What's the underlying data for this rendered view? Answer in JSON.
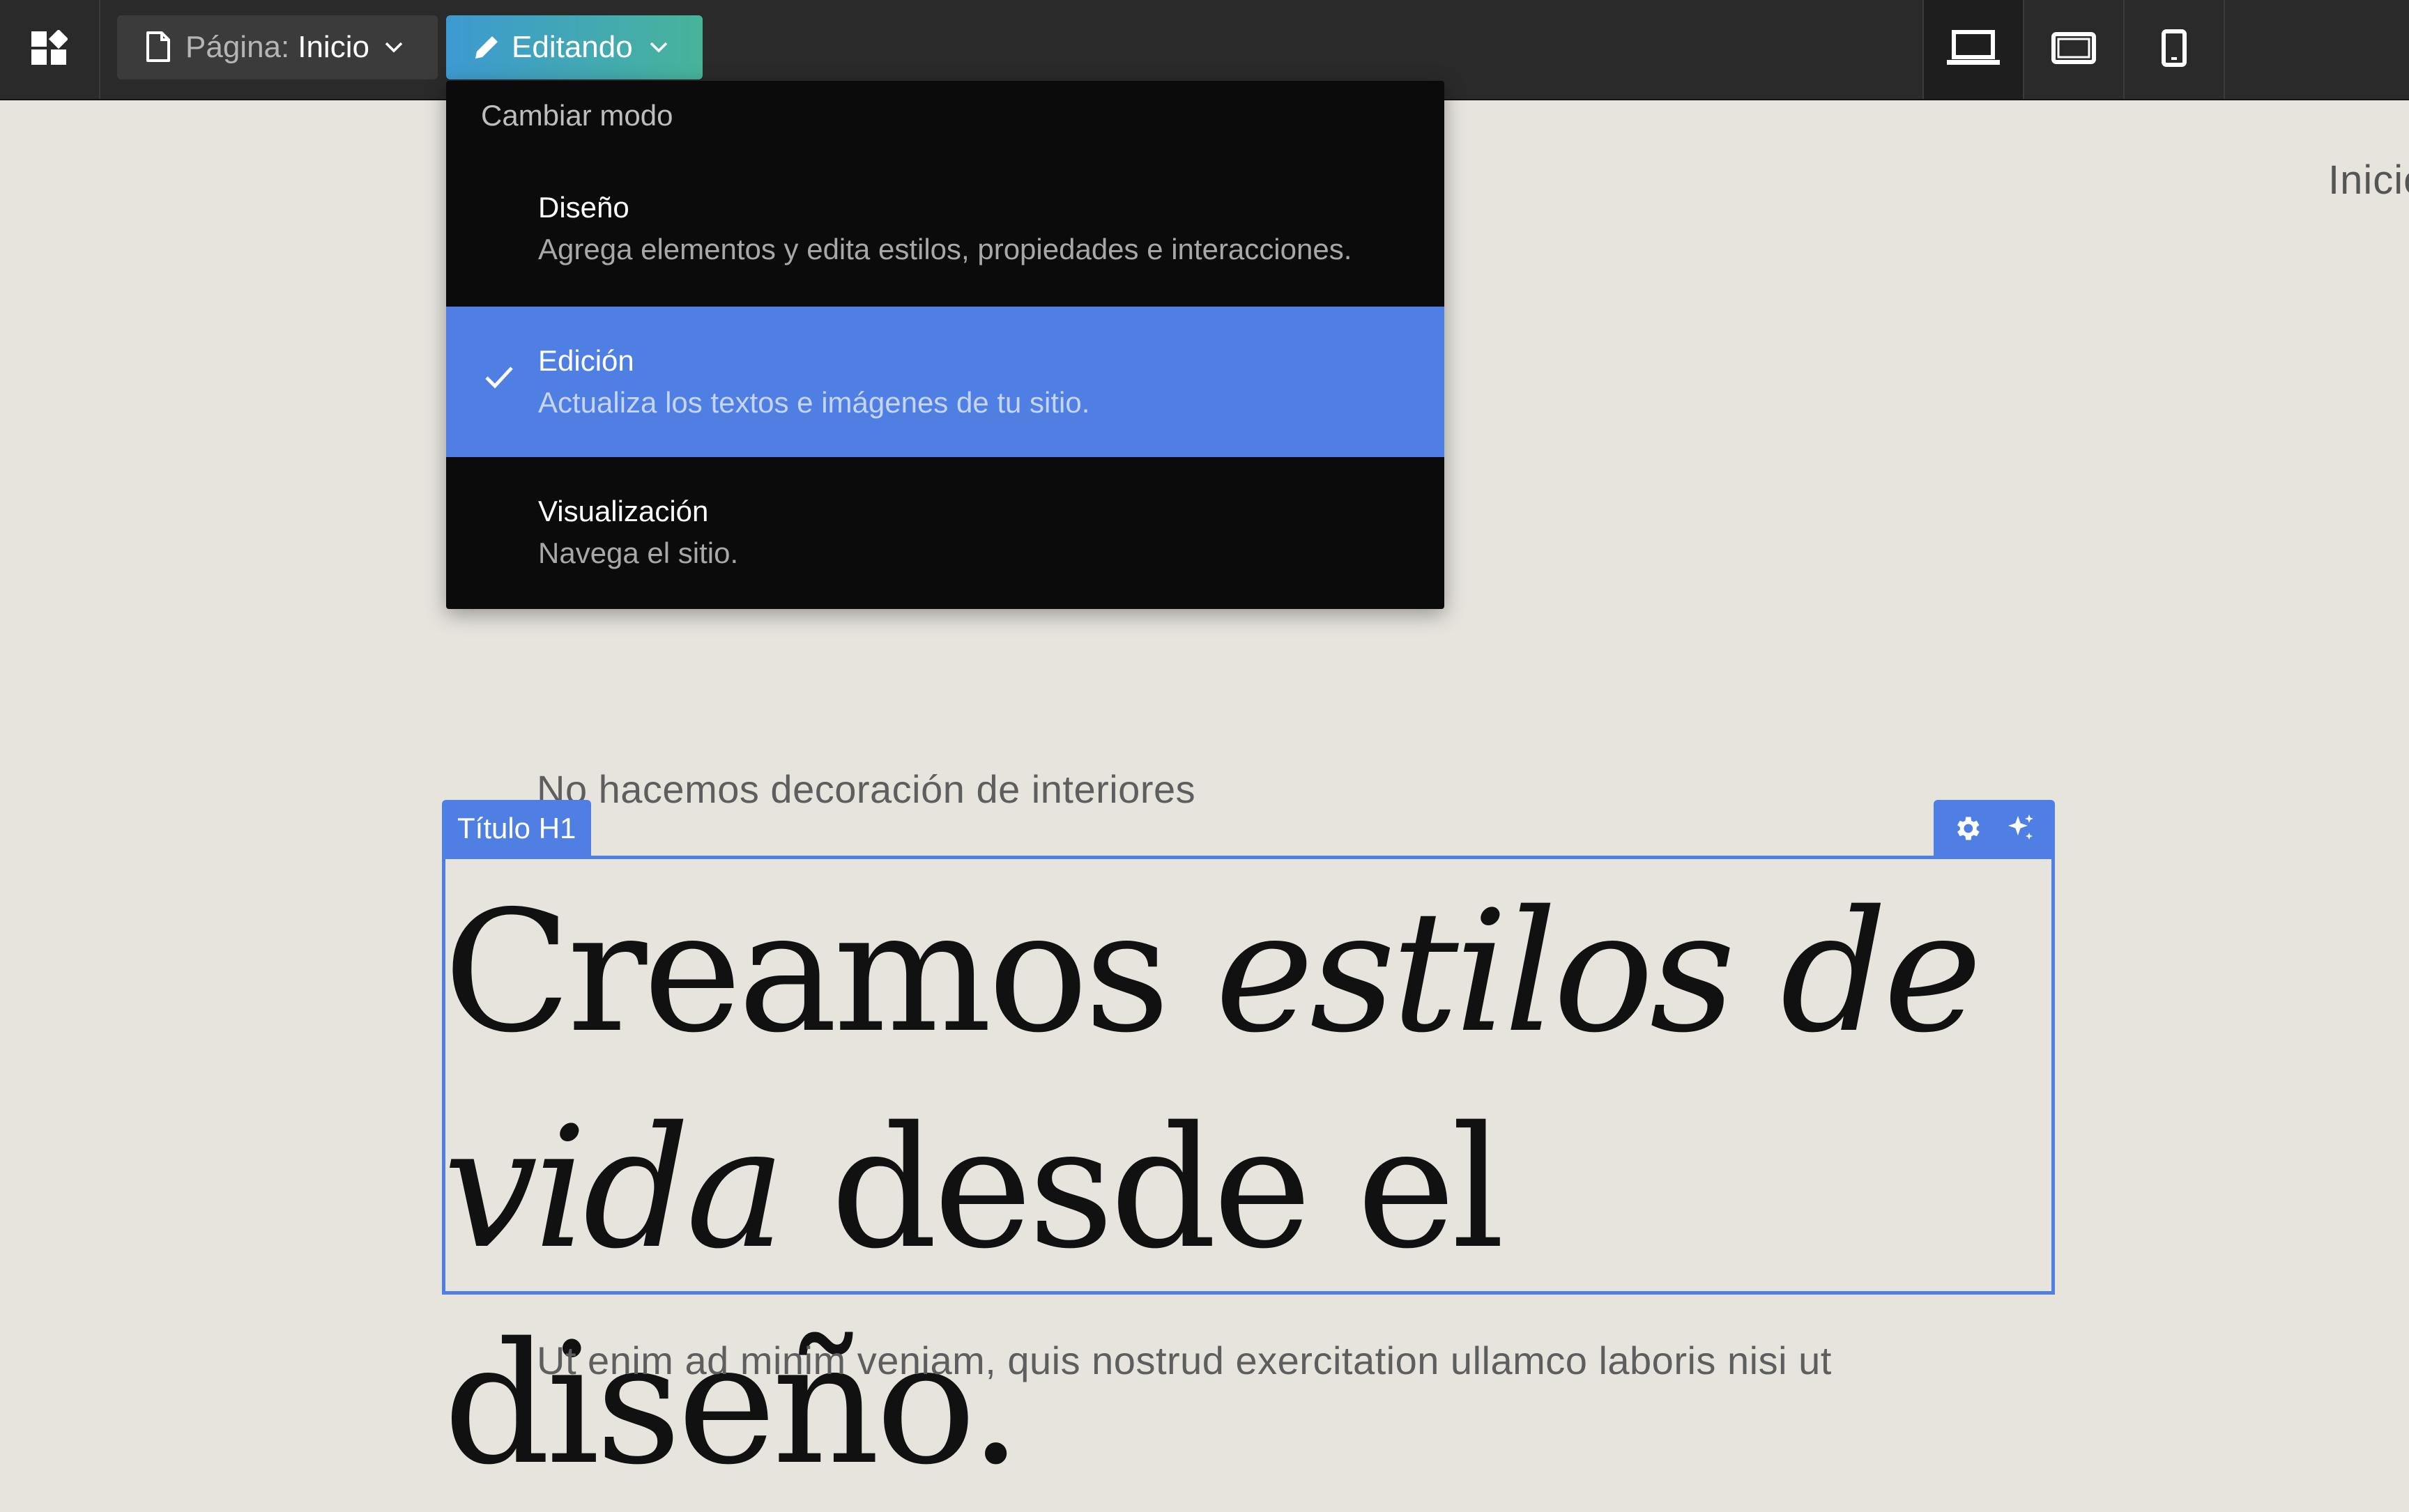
{
  "topbar": {
    "page_prefix": "Página:",
    "page_name": "Inicio",
    "mode_label": "Editando",
    "icons": {
      "logo": "webflow-grid-logo-icon",
      "page": "document-icon",
      "mode": "pencil-icon",
      "chevron": "chevron-down-icon",
      "devices": [
        "laptop-icon",
        "tablet-landscape-icon",
        "mobile-icon"
      ]
    },
    "active_device": "laptop"
  },
  "mode_menu": {
    "header": "Cambiar modo",
    "items": [
      {
        "title": "Diseño",
        "description": "Agrega elementos y edita estilos, propiedades e interacciones.",
        "selected": false
      },
      {
        "title": "Edición",
        "description": "Actualiza los textos e imágenes de tu sitio.",
        "selected": true
      },
      {
        "title": "Visualización",
        "description": "Navega el sitio.",
        "selected": false
      }
    ]
  },
  "canvas": {
    "nav_link": "Inicio",
    "eyebrow": "No hacemos decoración de interiores",
    "selection_label": "Título H1",
    "selection_tools": [
      "gear-icon",
      "sparkles-icon"
    ],
    "heading": {
      "part1": "Creamos ",
      "part2_italic": "estilos de vida",
      "part3": " desde el diseño."
    },
    "body_text": "Ut enim ad minim veniam, quis nostrud exercitation ullamco laboris nisi ut"
  },
  "colors": {
    "topbar_bg": "#2a2a2a",
    "canvas_bg": "#e7e4de",
    "accent_blue": "#4f7fe3",
    "mode_gradient_start": "#3d9ad1",
    "mode_gradient_end": "#47b49a",
    "menu_bg": "#0b0b0b"
  }
}
